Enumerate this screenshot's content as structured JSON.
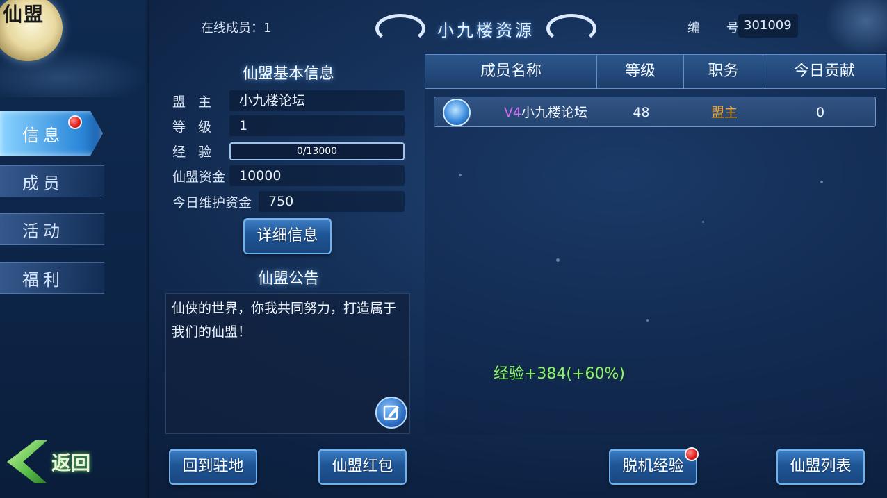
{
  "header": {
    "online_members_label": "在线成员：1",
    "title": "小九楼资源",
    "id_label": "编 号",
    "id_value": "301009"
  },
  "logo": {
    "text": "仙盟"
  },
  "nav": {
    "tabs": [
      {
        "label": "信息",
        "active": true,
        "has_badge": true
      },
      {
        "label": "成员",
        "active": false
      },
      {
        "label": "活动",
        "active": false
      },
      {
        "label": "福利",
        "active": false
      }
    ],
    "back_label": "返回"
  },
  "basic_info": {
    "title": "仙盟基本信息",
    "leader_label": "盟 主",
    "leader_value": "小九楼论坛",
    "level_label": "等 级",
    "level_value": "1",
    "exp_label": "经 验",
    "exp_text": "0/13000",
    "exp_current": 0,
    "exp_max": 13000,
    "funds_label": "仙盟资金",
    "funds_value": "10000",
    "upkeep_label": "今日维护资金",
    "upkeep_value": "750",
    "detail_button": "详细信息"
  },
  "notice": {
    "title": "仙盟公告",
    "text": "仙侠的世界，你我共同努力，打造属于我们的仙盟！"
  },
  "members": {
    "columns": [
      "成员名称",
      "等级",
      "职务",
      "今日贡献"
    ],
    "rows": [
      {
        "vip": "V4",
        "name": "小九楼论坛",
        "level": "48",
        "role": "盟主",
        "contribution": "0"
      }
    ]
  },
  "exp_gain_text": "经验+384(+60%)",
  "bottom_buttons": {
    "return_base": "回到驻地",
    "red_packet": "仙盟红包",
    "offline_exp": "脱机经验",
    "alliance_list": "仙盟列表"
  },
  "colors": {
    "vip": "#d06cf2",
    "role_leader": "#f3a31e",
    "exp_gain": "#8ff07a",
    "badge": "#e01b1b"
  }
}
